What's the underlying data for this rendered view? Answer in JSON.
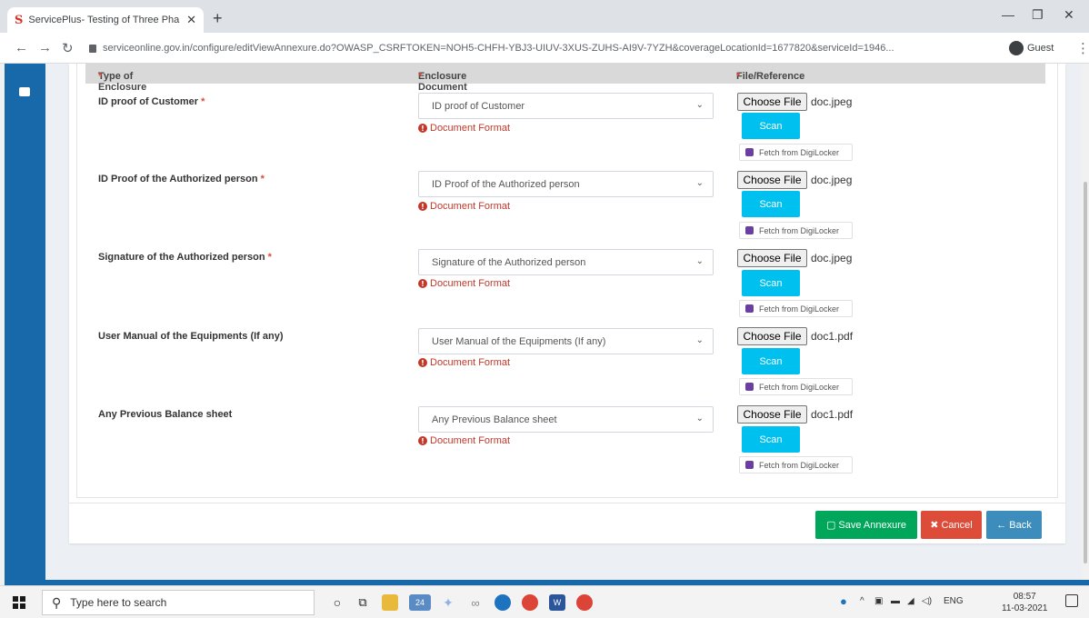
{
  "browser": {
    "tab_title": "ServicePlus- Testing of Three Pha",
    "url": "serviceonline.gov.in/configure/editViewAnnexure.do?OWASP_CSRFTOKEN=NOH5-CHFH-YBJ3-UIUV-3XUS-ZUHS-AI9V-7YZH&coverageLocationId=1677820&serviceId=1946...",
    "profile": "Guest"
  },
  "table": {
    "headers": {
      "type": "Type of Enclosure",
      "document": "Enclosure Document",
      "file": "File/Reference"
    },
    "required_mark": "*",
    "rows": [
      {
        "label": "ID proof of Customer",
        "required": "*",
        "selected": "ID proof of Customer",
        "format": "Document Format",
        "file": "doc.jpeg"
      },
      {
        "label": "ID Proof of the Authorized person",
        "required": "*",
        "selected": "ID Proof of the Authorized person",
        "format": "Document Format",
        "file": "doc.jpeg"
      },
      {
        "label": "Signature of the Authorized person",
        "required": "*",
        "selected": "Signature of the Authorized person",
        "format": "Document Format",
        "file": "doc.jpeg"
      },
      {
        "label": "User Manual of the Equipments (If any)",
        "required": "",
        "selected": "User Manual of the Equipments (If any)",
        "format": "Document Format",
        "file": "doc1.pdf"
      },
      {
        "label": "Any Previous Balance sheet",
        "required": "",
        "selected": "Any Previous Balance sheet",
        "format": "Document Format",
        "file": "doc1.pdf"
      }
    ],
    "choose_file_label": "Choose File",
    "scan_label": "Scan",
    "digilocker_label": "Fetch from DigiLocker"
  },
  "actions": {
    "save": "Save Annexure",
    "cancel": "Cancel",
    "back": "Back"
  },
  "taskbar": {
    "search_placeholder": "Type here to search",
    "mail_badge": "24",
    "lang": "ENG",
    "time": "08:57",
    "date": "11-03-2021"
  }
}
